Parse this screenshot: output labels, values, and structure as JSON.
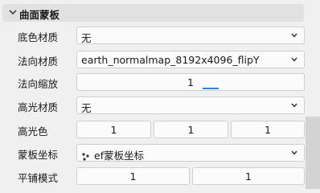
{
  "section": {
    "title": "曲面蒙板",
    "icon": "chevron-down-icon"
  },
  "rows": {
    "base_material": {
      "label": "底色材质",
      "value": "无"
    },
    "normal_material": {
      "label": "法向材质",
      "value": "earth_normalmap_8192x4096_flipY"
    },
    "normal_scale": {
      "label": "法向缩放",
      "value": "1"
    },
    "specular_material": {
      "label": "高光材质",
      "value": "无"
    },
    "specular_color": {
      "label": "高光色",
      "values": [
        "1",
        "1",
        "1"
      ]
    },
    "mask_coord": {
      "label": "蒙板坐标",
      "value": "ef蒙板坐标",
      "icon": "coordinate-dots-icon"
    },
    "tile_mode": {
      "label": "平铺模式",
      "values": [
        "1",
        "1"
      ]
    }
  },
  "colors": {
    "accent": "#2e86de",
    "header_bg": "#e1e1e1",
    "panel_bg": "#f0f0f0"
  }
}
